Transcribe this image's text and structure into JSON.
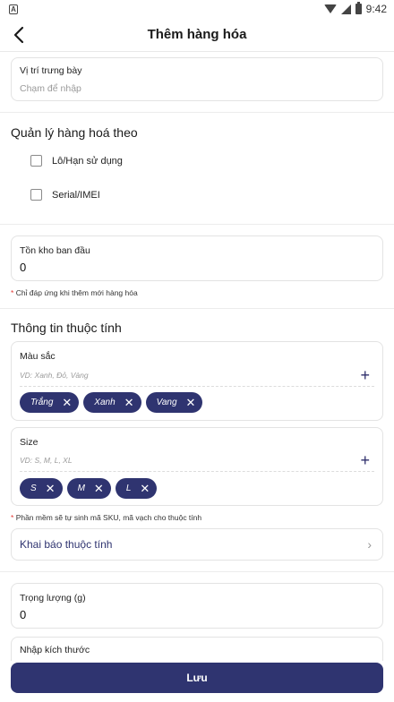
{
  "status_bar": {
    "time": "9:42",
    "sim_label": "A"
  },
  "header": {
    "title": "Thêm hàng hóa"
  },
  "display_location": {
    "label": "Vị trí trưng bày",
    "placeholder": "Chạm để nhập"
  },
  "manage_section": {
    "title": "Quản lý hàng hoá theo",
    "options": [
      {
        "label": "Lô/Hạn sử dụng",
        "checked": false
      },
      {
        "label": "Serial/IMEI",
        "checked": false
      }
    ]
  },
  "initial_stock": {
    "label": "Tồn kho ban đầu",
    "value": "0",
    "note_star": "*",
    "note": "Chỉ đáp ứng khi thêm mới hàng hóa"
  },
  "attributes": {
    "title": "Thông tin thuộc tính",
    "items": [
      {
        "name": "Màu sắc",
        "hint": "VD: Xanh, Đỏ, Vàng",
        "add_icon": "+",
        "values": [
          "Trắng",
          "Xanh",
          "Vang"
        ]
      },
      {
        "name": "Size",
        "hint": "VD: S, M, L, XL",
        "add_icon": "+",
        "values": [
          "S",
          "M",
          "L"
        ]
      }
    ],
    "note_star": "*",
    "note": "Phần mềm sẽ tự sinh mã SKU, mã vạch cho thuộc tính",
    "declare_label": "Khai báo thuộc tính",
    "chip_remove_icon": "✕",
    "declare_chevron": "›"
  },
  "weight": {
    "label": "Trọng lượng (g)",
    "value": "0"
  },
  "dimensions": {
    "label": "Nhập kích thước"
  },
  "save_label": "Lưu",
  "colors": {
    "primary": "#2f3470",
    "required_star": "#e53935"
  }
}
